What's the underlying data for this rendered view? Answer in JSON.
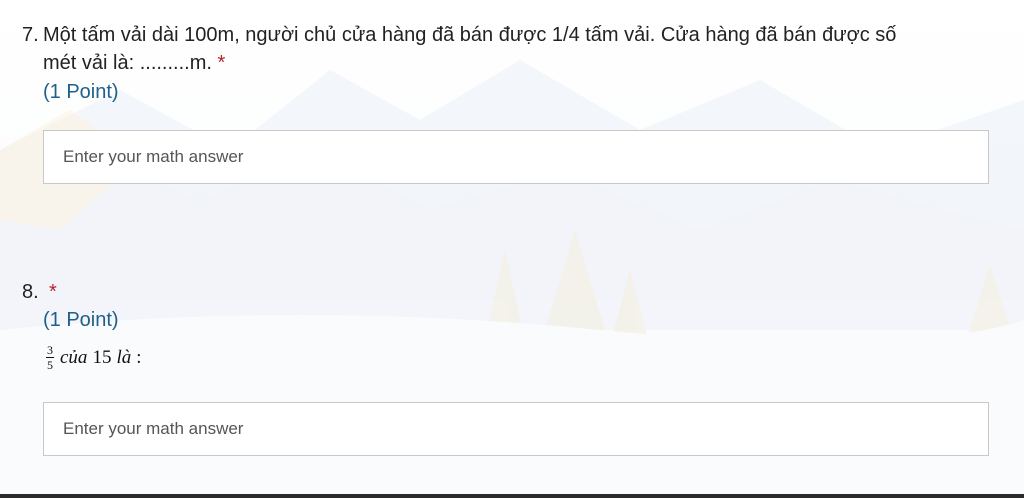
{
  "questions": [
    {
      "number": "7.",
      "text_line1": "Một tấm vải dài 100m, người chủ cửa hàng đã bán được 1/4 tấm vải. Cửa hàng đã bán được số",
      "text_line2": "mét vải là: .........m.",
      "required_mark": "*",
      "points": "(1 Point)",
      "answer": {
        "value": "",
        "placeholder": "Enter your math answer"
      }
    },
    {
      "number": "8.",
      "required_mark": "*",
      "points": "(1 Point)",
      "math": {
        "numerator": "3",
        "denominator": "5",
        "word1": "của",
        "number": "15",
        "word2": "là",
        "colon": ":"
      },
      "answer": {
        "value": "",
        "placeholder": "Enter your math answer"
      }
    }
  ],
  "colors": {
    "required": "#b4232b",
    "points": "#1f5f8b",
    "border": "#c8c8c8",
    "background": "#ffffff"
  }
}
